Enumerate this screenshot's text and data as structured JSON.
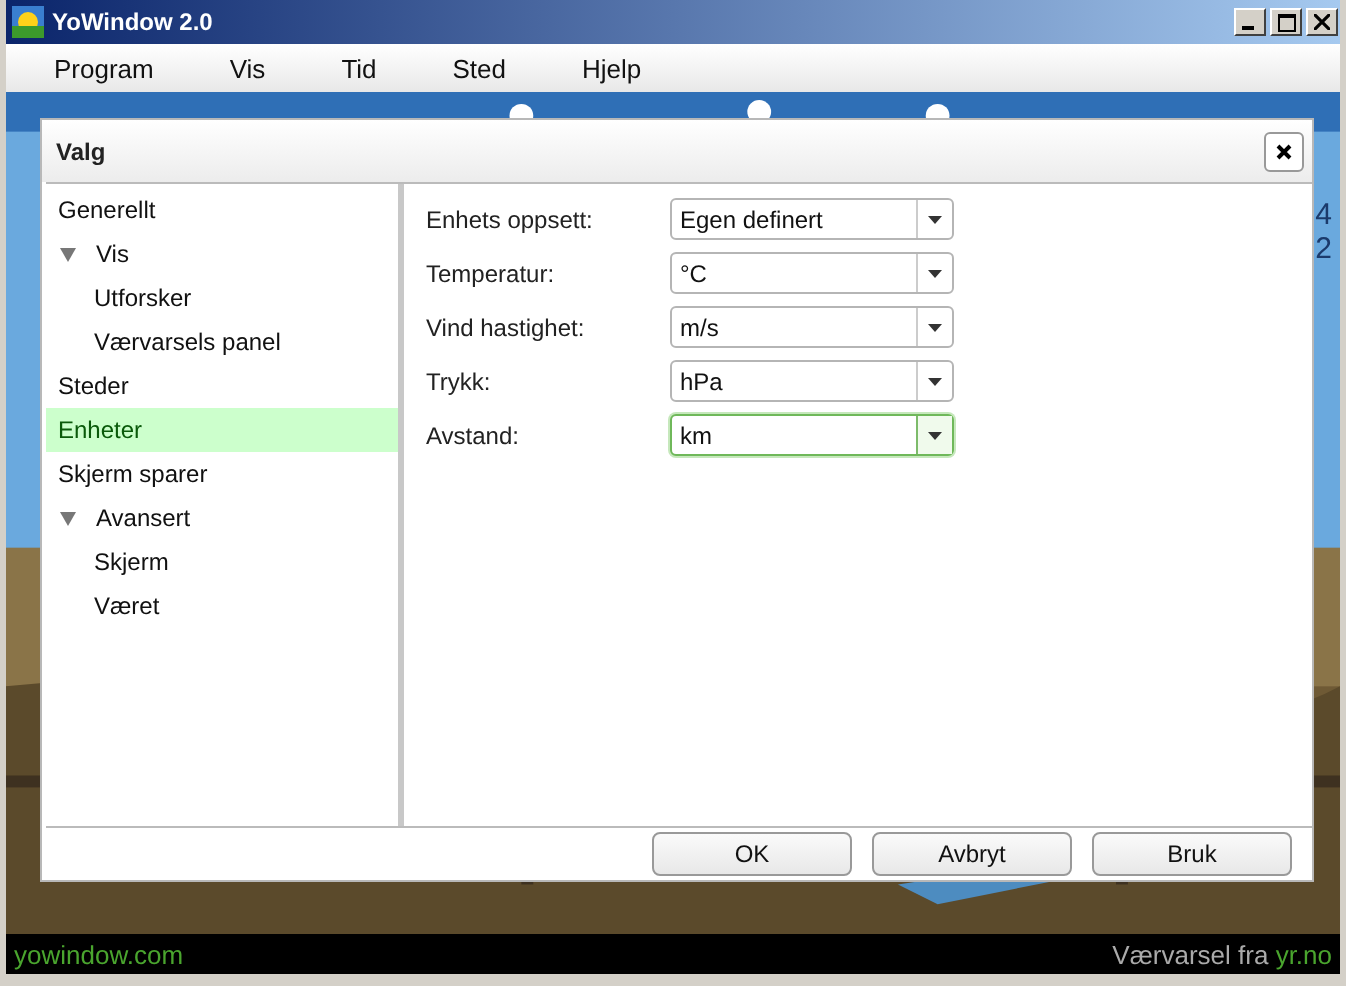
{
  "window": {
    "title": "YoWindow 2.0"
  },
  "menu": [
    "Program",
    "Vis",
    "Tid",
    "Sted",
    "Hjelp"
  ],
  "side_readings": [
    "4",
    "2"
  ],
  "dialog": {
    "title": "Valg",
    "tree": [
      {
        "label": "Generellt",
        "selected": false
      },
      {
        "label": "Vis",
        "selected": false,
        "expanded": true,
        "children": [
          {
            "label": "Utforsker",
            "selected": false
          },
          {
            "label": "Værvarsels panel",
            "selected": false
          }
        ]
      },
      {
        "label": "Steder",
        "selected": false
      },
      {
        "label": "Enheter",
        "selected": true
      },
      {
        "label": "Skjerm sparer",
        "selected": false
      },
      {
        "label": "Avansert",
        "selected": false,
        "expanded": true,
        "children": [
          {
            "label": "Skjerm",
            "selected": false
          },
          {
            "label": "Været",
            "selected": false
          }
        ]
      }
    ],
    "settings": [
      {
        "label": "Enhets oppsett:",
        "value": "Egen definert",
        "focused": false
      },
      {
        "label": "Temperatur:",
        "value": "°C",
        "focused": false
      },
      {
        "label": "Vind hastighet:",
        "value": "m/s",
        "focused": false
      },
      {
        "label": "Trykk:",
        "value": "hPa",
        "focused": false
      },
      {
        "label": "Avstand:",
        "value": "km",
        "focused": true
      }
    ],
    "buttons": [
      "OK",
      "Avbryt",
      "Bruk"
    ]
  },
  "status_bar": {
    "site": "yowindow.com",
    "credit_prefix": "Værvarsel fra",
    "credit_link": "yr.no"
  }
}
